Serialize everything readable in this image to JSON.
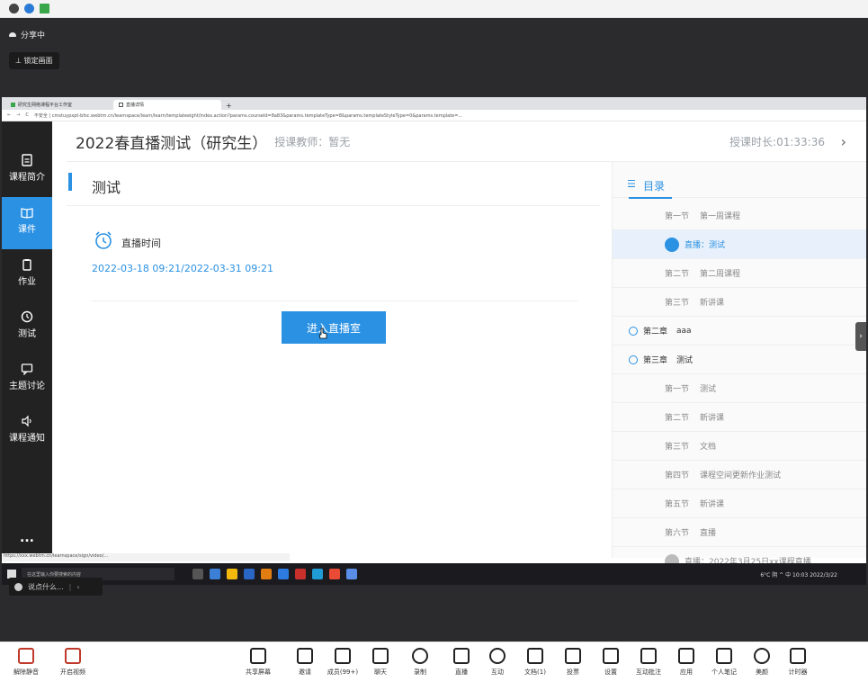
{
  "meeting": {
    "share_status": "分享中",
    "lock_screen": "锁定画面",
    "chat_placeholder": "说点什么...",
    "colors": {
      "background": "#2b2b2d",
      "accent": "#2b91e3"
    }
  },
  "browser": {
    "tabs": [
      {
        "label": "研究生网络课程平台工作室"
      },
      {
        "label": "直播详情"
      }
    ],
    "url": "不安全 | cmstuypxpt-bfsc.webtrn.cn/learnspace/learn/learn/templateeight/index.action?params.courseId=8a83&params.templateType=8&params.templateStyleType=0&params.template=..."
  },
  "app": {
    "course_title": "2022春直播测试（研究生）",
    "teacher": "授课教师：暂无",
    "duration": "授课时长:01:33:36",
    "sidebar": [
      {
        "label": "课程简介",
        "icon": "document-icon"
      },
      {
        "label": "课件",
        "icon": "book-icon",
        "active": true
      },
      {
        "label": "作业",
        "icon": "clipboard-icon"
      },
      {
        "label": "测试",
        "icon": "clock-icon"
      },
      {
        "label": "主题讨论",
        "icon": "chat-icon"
      },
      {
        "label": "课程通知",
        "icon": "speaker-icon"
      }
    ],
    "more": "...",
    "main": {
      "title": "测试",
      "live_time_label": "直播时间",
      "live_time_value": "2022-03-18 09:21/2022-03-31 09:21",
      "enter_button": "进入直播室"
    },
    "catalog": {
      "title": "目录",
      "rows": [
        {
          "kind": "section",
          "num": "第一节",
          "text": "第一周课程"
        },
        {
          "kind": "live",
          "text": "直播：测试",
          "highlight": true
        },
        {
          "kind": "section",
          "num": "第二节",
          "text": "第二周课程"
        },
        {
          "kind": "section",
          "num": "第三节",
          "text": "新讲课"
        },
        {
          "kind": "chapter",
          "num": "第二章",
          "text": "aaa"
        },
        {
          "kind": "chapter",
          "num": "第三章",
          "text": "测试"
        },
        {
          "kind": "section",
          "num": "第一节",
          "text": "测试"
        },
        {
          "kind": "section",
          "num": "第二节",
          "text": "新讲课"
        },
        {
          "kind": "section",
          "num": "第三节",
          "text": "文档"
        },
        {
          "kind": "section",
          "num": "第四节",
          "text": "课程空间更新作业测试"
        },
        {
          "kind": "section",
          "num": "第五节",
          "text": "新讲课"
        },
        {
          "kind": "section",
          "num": "第六节",
          "text": "直播"
        },
        {
          "kind": "live",
          "text": "直播：2022年3月25日xx课程直播"
        }
      ]
    },
    "status_url": "https://xxx.webtrn.cn/learnspace/sign/video/...",
    "taskbar": {
      "search_placeholder": "在这里输入你要搜索的内容",
      "right_text": "6°C 阴  ^  中  10:03  2022/3/22"
    }
  },
  "toolbar": {
    "items": [
      {
        "label": "解除静音",
        "icon": "mic-muted-icon"
      },
      {
        "label": "开启视频",
        "icon": "camera-off-icon"
      },
      {
        "label": "共享屏幕",
        "icon": "share-screen-icon"
      },
      {
        "label": "邀请",
        "icon": "invite-icon"
      },
      {
        "label": "成员(99+)",
        "icon": "members-icon"
      },
      {
        "label": "聊天",
        "icon": "chat-icon"
      },
      {
        "label": "录制",
        "icon": "record-icon"
      },
      {
        "label": "直播",
        "icon": "live-icon"
      },
      {
        "label": "互动",
        "icon": "interact-icon"
      },
      {
        "label": "文档(1)",
        "icon": "document-icon"
      },
      {
        "label": "投票",
        "icon": "vote-icon"
      },
      {
        "label": "设置",
        "icon": "settings-icon"
      },
      {
        "label": "互动批注",
        "icon": "annotate-icon"
      },
      {
        "label": "应用",
        "icon": "apps-icon"
      },
      {
        "label": "个人笔记",
        "icon": "notes-icon"
      },
      {
        "label": "美颜",
        "icon": "beauty-icon"
      },
      {
        "label": "计时器",
        "icon": "timer-icon"
      }
    ]
  }
}
